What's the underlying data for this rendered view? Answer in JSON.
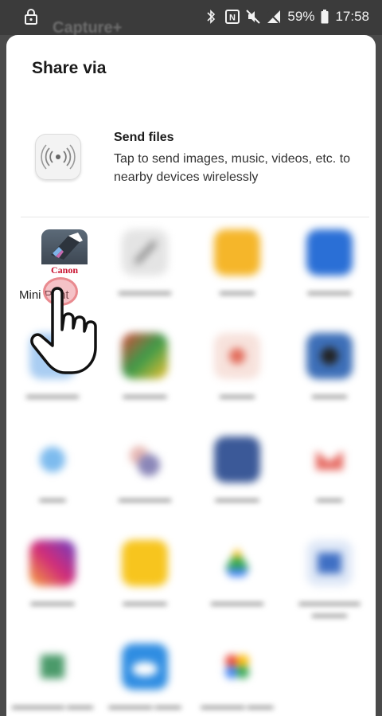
{
  "status_bar": {
    "battery_percent": "59%",
    "time": "17:58",
    "left_icon": "lock-icon",
    "right_icons": [
      "bluetooth-icon",
      "nfc-icon",
      "mute-icon",
      "no-signal-icon",
      "battery-icon"
    ]
  },
  "background_app": {
    "title": "Capture+"
  },
  "share_sheet": {
    "title": "Share via",
    "send_files": {
      "title": "Send files",
      "description": "Tap to send images, music, videos, etc. to nearby devices wirelessly",
      "icon": "wireless-broadcast-icon"
    },
    "apps": [
      {
        "label": "Mini Print",
        "brand": "Canon",
        "icon": "canon-mini-print-icon",
        "color": "#4a5663"
      },
      {
        "label": "",
        "icon": "pen-app-icon",
        "color": "#c9c9c9"
      },
      {
        "label": "",
        "icon": "folder-app-icon",
        "color": "#f5b62a"
      },
      {
        "label": "",
        "icon": "bluetooth-app-icon",
        "color": "#2a6fd6"
      },
      {
        "label": "",
        "icon": "blurred-app-icon",
        "color": "#4a8fe0"
      },
      {
        "label": "",
        "icon": "maps-app-icon",
        "color": "#3c9a4a"
      },
      {
        "label": "",
        "icon": "red-app-icon",
        "color": "#e8a79b"
      },
      {
        "label": "",
        "icon": "camera-app-icon",
        "color": "#2f5fa5"
      },
      {
        "label": "",
        "icon": "circle-app-icon",
        "color": "#5aa7e6"
      },
      {
        "label": "",
        "icon": "cluster-app-icon",
        "color": "#9a87a8"
      },
      {
        "label": "",
        "icon": "facebook-app-icon",
        "color": "#3b5998"
      },
      {
        "label": "",
        "icon": "gmail-app-icon",
        "color": "#d6453e"
      },
      {
        "label": "",
        "icon": "instagram-app-icon",
        "color": "#c13584"
      },
      {
        "label": "",
        "icon": "message-app-icon",
        "color": "#f7c51e"
      },
      {
        "label": "",
        "icon": "drive-app-icon",
        "color": "#34a853"
      },
      {
        "label": "",
        "icon": "photo-app-icon",
        "color": "#3f6fc4"
      },
      {
        "label": "",
        "icon": "sheets-app-icon",
        "color": "#2e8a57"
      },
      {
        "label": "",
        "icon": "cloud-app-icon",
        "color": "#2f8de2"
      },
      {
        "label": "",
        "icon": "pinwheel-app-icon",
        "color": "#e9a13b"
      }
    ]
  },
  "overlay": {
    "tap_indicator_color": "#e98a8f",
    "hand_icon": "pointing-hand-icon"
  }
}
